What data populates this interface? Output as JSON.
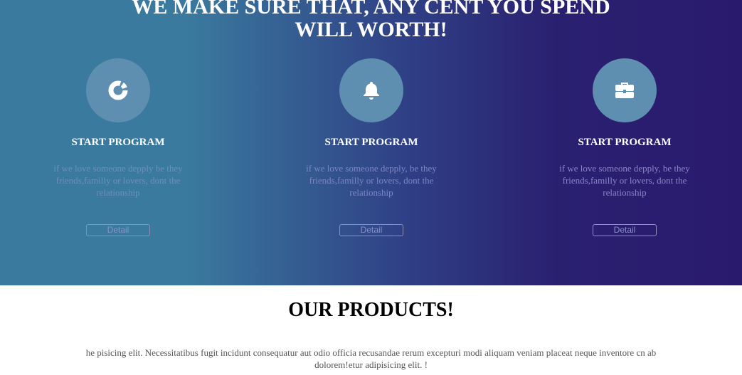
{
  "hero": {
    "title_line1": "WE MAKE SURE THAT, ANY CENT YOU SPEND",
    "title_line2": "WILL WORTH!",
    "features": [
      {
        "icon": "chart-pie-icon",
        "title": "START PROGRAM",
        "text": "if we love someone depply be they friends,familly or lovers, dont the relationship",
        "button": "Detail"
      },
      {
        "icon": "bell-icon",
        "title": "START PROGRAM",
        "text": "if we love someone depply, be they friends,familly or lovers, dont the relationship",
        "button": "Detail"
      },
      {
        "icon": "briefcase-icon",
        "title": "START PROGRAM",
        "text": "if we love someone depply, be they friends,familly or lovers, dont the relationship",
        "button": "Detail"
      }
    ],
    "colors": {
      "gradient_start": "#3a7a9e",
      "gradient_end": "#2a1a6e",
      "icon_circle": "#5f8fb0"
    }
  },
  "products": {
    "title": "OUR PRODUCTS!",
    "text": "he pisicing elit. Necessitatibus fugit incidunt consequatur aut odio officia recusandae rerum excepturi modi aliquam veniam placeat neque inventore cn ab dolorem!etur adipisicing elit. !"
  }
}
